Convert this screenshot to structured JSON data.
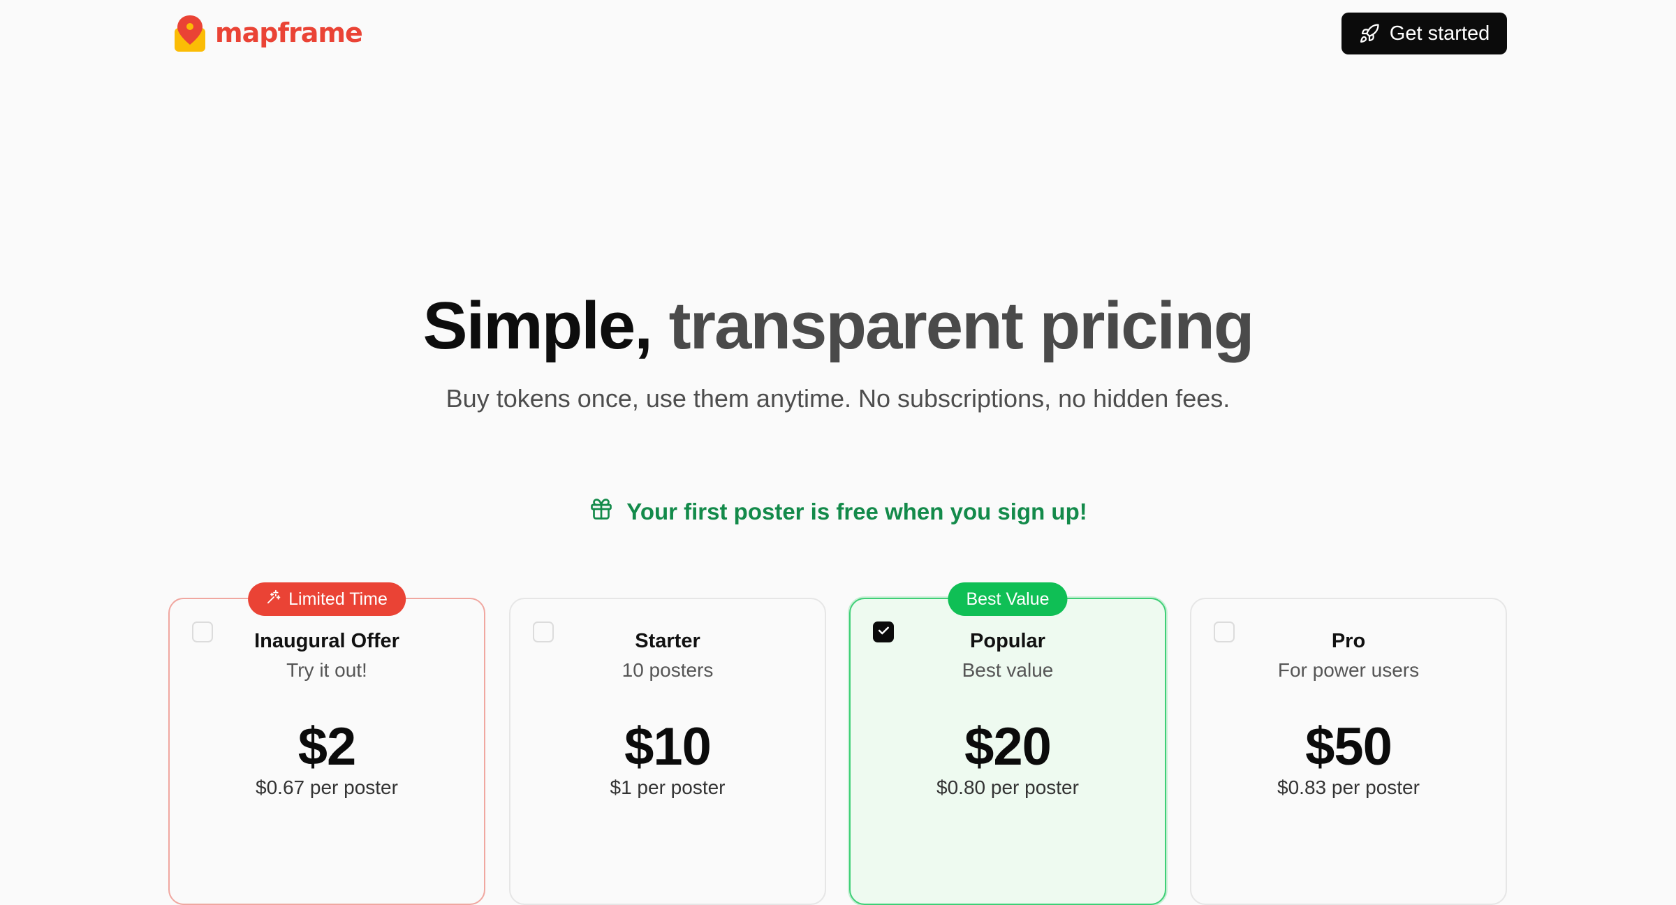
{
  "brand": {
    "name": "mapframe",
    "color": "#ea4335"
  },
  "nav": {
    "cta_label": "Get started",
    "cta_icon": "rocket-icon"
  },
  "hero": {
    "title_part1": "Simple,",
    "title_part2": "transparent pricing",
    "subtitle": "Buy tokens once, use them anytime. No subscriptions, no hidden fees."
  },
  "promo": {
    "icon": "gift-icon",
    "text": "Your first poster is free when you sign up!",
    "color": "#138a4a"
  },
  "plans": [
    {
      "badge": "Limited Time",
      "badge_icon": "sparkle-icon",
      "name": "Inaugural Offer",
      "desc": "Try it out!",
      "price": "$2",
      "per": "$0.67 per poster",
      "selected": false
    },
    {
      "name": "Starter",
      "desc": "10 posters",
      "price": "$10",
      "per": "$1 per poster",
      "selected": false
    },
    {
      "badge": "Best Value",
      "name": "Popular",
      "desc": "Best value",
      "price": "$20",
      "per": "$0.80 per poster",
      "selected": true
    },
    {
      "name": "Pro",
      "desc": "For power users",
      "price": "$50",
      "per": "$0.83 per poster",
      "selected": false
    }
  ]
}
